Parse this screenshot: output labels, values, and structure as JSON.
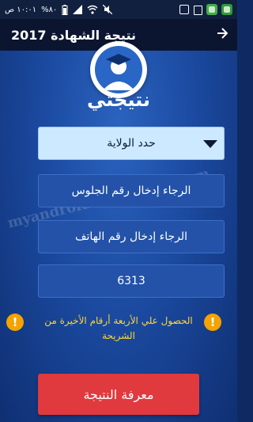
{
  "status_bar": {
    "time": "١٠:٠١ ص",
    "battery": "%٨٠"
  },
  "header": {
    "title": "نتيجة الشهادة 2017",
    "back_icon": "arrow-right-icon"
  },
  "logo": {
    "title": "نتيجتي"
  },
  "form": {
    "state_select": "حدد الولاية",
    "seat_number_placeholder": "الرجاء إدخال رقم الجلوس",
    "phone_number_placeholder": "الرجاء إدخال رقم الهاتف",
    "code_value": "6313"
  },
  "info_note": {
    "text": "الحصول علي الأربعة أرقام الأخيرة من الشريحة"
  },
  "submit": {
    "label": "معرفة النتيجة"
  },
  "watermark": "myandroiddownloads.com",
  "colors": {
    "background": "#1b4aa0",
    "header": "#0c1530",
    "select_bg": "#cde9ff",
    "field_bg": "#2352a8",
    "warning": "#f4a300",
    "note_text": "#ffd633",
    "submit": "#e0393e"
  }
}
